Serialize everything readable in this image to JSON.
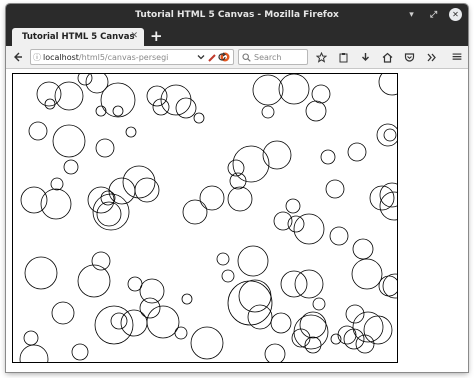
{
  "window": {
    "title": "Tutorial HTML 5 Canvas - Mozilla Firefox",
    "controls": {
      "minimize": "▾",
      "maximize": "⤢",
      "close": "✕"
    }
  },
  "tabs": [
    {
      "label": "Tutorial HTML 5 Canvas",
      "close": "✕"
    }
  ],
  "new_tab_label": "+",
  "navbar": {
    "back_icon": "‹",
    "url_host": "localhost",
    "url_path": "/html5/canvas-persegi",
    "search_placeholder": "Search",
    "menu_icon": "≡"
  },
  "canvas": {
    "stroke_color": "#000000",
    "circles": [
      [
        36,
        20,
        12
      ],
      [
        72,
        4,
        7
      ],
      [
        56,
        22,
        14
      ],
      [
        84,
        8,
        11
      ],
      [
        37,
        30,
        5
      ],
      [
        88,
        37,
        5
      ],
      [
        25,
        57,
        9
      ],
      [
        56,
        67,
        16
      ],
      [
        92,
        74,
        9
      ],
      [
        118,
        58,
        5
      ],
      [
        105,
        26,
        17
      ],
      [
        105,
        37,
        5
      ],
      [
        144,
        22,
        10
      ],
      [
        163,
        26,
        15
      ],
      [
        148,
        33,
        8
      ],
      [
        173,
        34,
        10
      ],
      [
        186,
        44,
        5
      ],
      [
        255,
        16,
        15
      ],
      [
        281,
        15,
        15
      ],
      [
        308,
        20,
        9
      ],
      [
        303,
        37,
        10
      ],
      [
        379,
        8,
        13
      ],
      [
        375,
        61,
        11
      ],
      [
        255,
        38,
        6
      ],
      [
        238,
        90,
        18
      ],
      [
        264,
        81,
        14
      ],
      [
        315,
        83,
        7
      ],
      [
        322,
        115,
        9
      ],
      [
        344,
        78,
        9
      ],
      [
        377,
        61,
        6
      ],
      [
        21,
        126,
        13
      ],
      [
        43,
        130,
        15
      ],
      [
        58,
        93,
        7
      ],
      [
        44,
        110,
        6
      ],
      [
        88,
        126,
        13
      ],
      [
        95,
        124,
        7
      ],
      [
        98,
        138,
        18
      ],
      [
        109,
        117,
        13
      ],
      [
        126,
        108,
        16
      ],
      [
        134,
        116,
        12
      ],
      [
        96,
        140,
        12
      ],
      [
        182,
        138,
        12
      ],
      [
        199,
        124,
        12
      ],
      [
        227,
        125,
        12
      ],
      [
        225,
        107,
        8
      ],
      [
        223,
        94,
        8
      ],
      [
        280,
        132,
        7
      ],
      [
        283,
        150,
        8
      ],
      [
        270,
        147,
        9
      ],
      [
        296,
        155,
        15
      ],
      [
        326,
        162,
        9
      ],
      [
        350,
        175,
        10
      ],
      [
        369,
        124,
        12
      ],
      [
        379,
        121,
        12
      ],
      [
        381,
        132,
        14
      ],
      [
        28,
        199,
        16
      ],
      [
        81,
        207,
        16
      ],
      [
        88,
        187,
        9
      ],
      [
        122,
        210,
        7
      ],
      [
        139,
        217,
        12
      ],
      [
        101,
        251,
        19
      ],
      [
        121,
        249,
        13
      ],
      [
        137,
        234,
        10
      ],
      [
        106,
        247,
        8
      ],
      [
        50,
        239,
        11
      ],
      [
        174,
        225,
        5
      ],
      [
        150,
        248,
        16
      ],
      [
        168,
        259,
        6
      ],
      [
        18,
        264,
        7
      ],
      [
        21,
        285,
        14
      ],
      [
        67,
        278,
        8
      ],
      [
        194,
        269,
        16
      ],
      [
        210,
        185,
        6
      ],
      [
        215,
        202,
        6
      ],
      [
        240,
        187,
        15
      ],
      [
        242,
        222,
        16
      ],
      [
        237,
        229,
        22
      ],
      [
        247,
        243,
        12
      ],
      [
        268,
        249,
        10
      ],
      [
        281,
        210,
        13
      ],
      [
        296,
        210,
        14
      ],
      [
        306,
        230,
        6
      ],
      [
        262,
        280,
        10
      ],
      [
        288,
        264,
        9
      ],
      [
        298,
        258,
        17
      ],
      [
        300,
        251,
        13
      ],
      [
        300,
        271,
        8
      ],
      [
        323,
        265,
        5
      ],
      [
        334,
        261,
        9
      ],
      [
        342,
        240,
        9
      ],
      [
        355,
        253,
        15
      ],
      [
        352,
        270,
        9
      ],
      [
        354,
        200,
        15
      ],
      [
        365,
        256,
        14
      ],
      [
        376,
        212,
        10
      ],
      [
        382,
        212,
        12
      ],
      [
        341,
        265,
        10
      ]
    ]
  }
}
